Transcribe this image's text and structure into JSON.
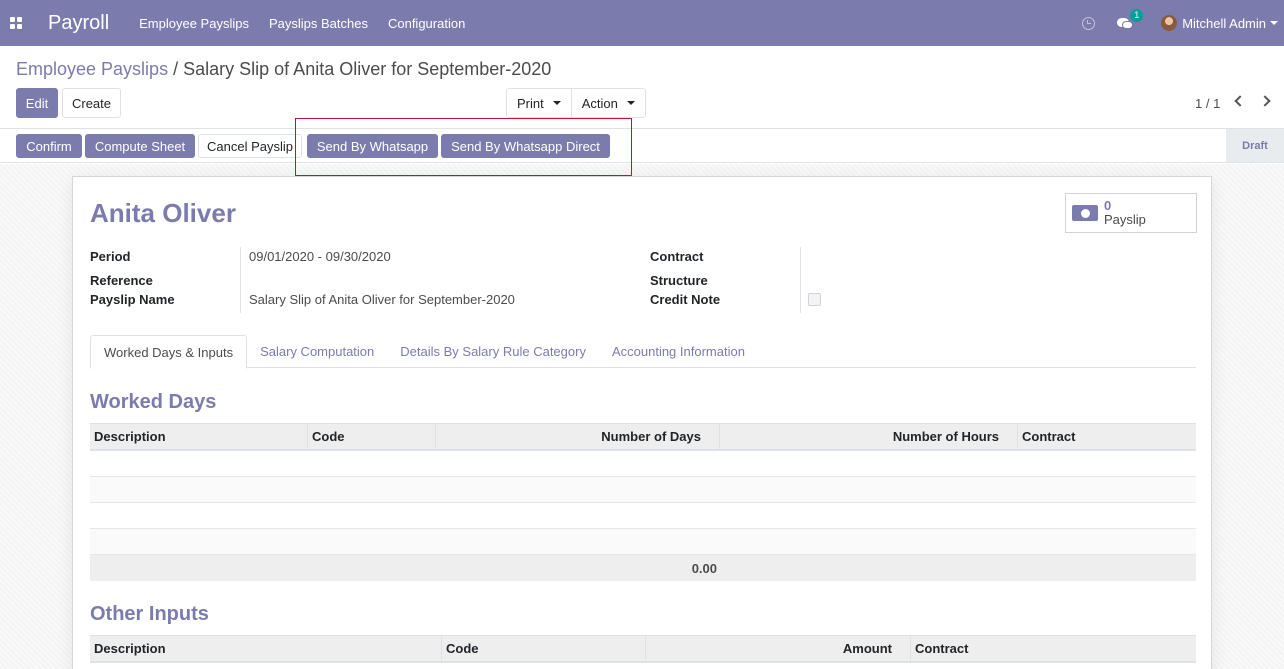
{
  "navbar": {
    "brand": "Payroll",
    "menu": [
      "Employee Payslips",
      "Payslips Batches",
      "Configuration"
    ],
    "chat_badge": "1",
    "user_name": "Mitchell Admin"
  },
  "breadcrumb": {
    "parent": "Employee Payslips",
    "separator": "/",
    "current": "Salary Slip of Anita Oliver for September-2020"
  },
  "control": {
    "edit": "Edit",
    "create": "Create",
    "print": "Print",
    "action": "Action",
    "pager": "1 / 1"
  },
  "statusbar": {
    "confirm": "Confirm",
    "compute_sheet": "Compute Sheet",
    "cancel_payslip": "Cancel Payslip",
    "send_whatsapp": "Send By Whatsapp",
    "send_whatsapp_direct": "Send By Whatsapp Direct",
    "state": "Draft"
  },
  "form": {
    "employee_name": "Anita Oliver",
    "smart_button": {
      "value": "0",
      "label": "Payslip"
    },
    "fields_left": [
      {
        "label": "Period",
        "value": "09/01/2020 - 09/30/2020"
      },
      {
        "label": "Reference",
        "value": ""
      },
      {
        "label": "Payslip Name",
        "value": "Salary Slip of Anita Oliver for September-2020"
      }
    ],
    "fields_right": [
      {
        "label": "Contract",
        "value": ""
      },
      {
        "label": "Structure",
        "value": ""
      },
      {
        "label": "Credit Note",
        "value": ""
      }
    ],
    "tabs": [
      "Worked Days & Inputs",
      "Salary Computation",
      "Details By Salary Rule Category",
      "Accounting Information"
    ],
    "worked_days": {
      "title": "Worked Days",
      "columns": [
        "Description",
        "Code",
        "Number of Days",
        "Number of Hours",
        "Contract"
      ],
      "total": "0.00"
    },
    "other_inputs": {
      "title": "Other Inputs",
      "columns": [
        "Description",
        "Code",
        "Amount",
        "Contract"
      ]
    }
  },
  "colors": {
    "brand": "#7c7bad",
    "highlight": "#c8102e",
    "badge": "#00a09d"
  }
}
